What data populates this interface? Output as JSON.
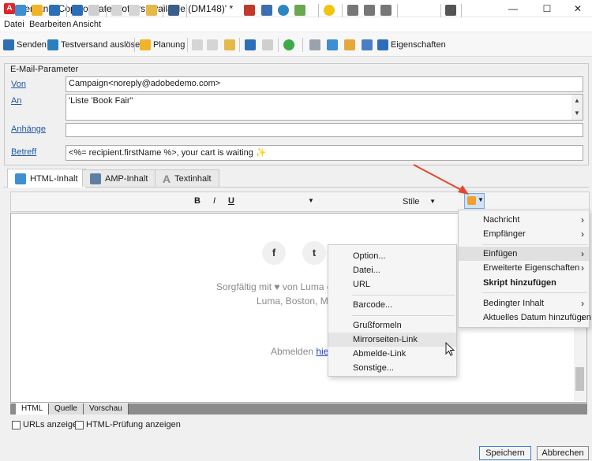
{
  "window": {
    "title": "Versand  'Copy of Latest offers available (DM148)' *",
    "app_icon": "A",
    "minimize": "—",
    "maximize": "☐",
    "close": "✕"
  },
  "menu": [
    "Datei",
    "Bearbeiten",
    "Ansicht"
  ],
  "toolbar": {
    "send": "Senden",
    "test_send": "Testversand auslösen",
    "planning": "Planung",
    "properties": "Eigenschaften"
  },
  "params": {
    "group_title": "E-Mail-Parameter",
    "from_label": "Von",
    "from_value": "Campaign<noreply@adobedemo.com>",
    "to_label": "An",
    "to_value": "'Liste 'Book Fair''",
    "attachments_label": "Anhänge",
    "attachments_value": "",
    "subject_label": "Betreff",
    "subject_value": "<%= recipient.firstName %>, your cart is waiting ✨"
  },
  "content_tabs": [
    "HTML-Inhalt",
    "AMP-Inhalt",
    "Textinhalt"
  ],
  "editor_toolbar": {
    "bold": "B",
    "italic": "I",
    "underline": "U",
    "styles": "Stile"
  },
  "editor": {
    "social_facebook": "f",
    "social_twitter": "t",
    "footer_line1": "Sorgfältig mit ♥ von Luma g",
    "footer_line2": "Luma, Boston, M",
    "unsubscribe_text": "Abmelden ",
    "unsubscribe_link": "hier"
  },
  "editor_tabs": [
    "HTML",
    "Quelle",
    "Vorschau"
  ],
  "checkboxes": {
    "show_urls": "URLs anzeigen",
    "html_check": "HTML-Prüfung anzeigen"
  },
  "buttons": {
    "save": "Speichern",
    "cancel": "Abbrechen"
  },
  "main_menu": {
    "items": [
      {
        "label": "Nachricht",
        "submenu": true
      },
      {
        "label": "Empfänger",
        "submenu": true
      },
      {
        "label": "Einfügen",
        "submenu": true
      },
      {
        "label": "Erweiterte Eigenschaften",
        "submenu": true
      },
      {
        "label": "Skript hinzufügen",
        "submenu": false
      },
      {
        "label": "Bedingter Inhalt",
        "submenu": true
      },
      {
        "label": "Aktuelles Datum hinzufügen",
        "submenu": true
      }
    ],
    "submenu_arrow": "›"
  },
  "insert_menu": {
    "items": [
      "Option...",
      "Datei...",
      "URL",
      "Barcode...",
      "Grußformeln",
      "Mirrorseiten-Link",
      "Abmelde-Link",
      "Sonstige..."
    ]
  },
  "colors": {
    "annotation_arrow": "#e0492f",
    "link": "#1f57a8",
    "brand_red": "#e0252b"
  }
}
